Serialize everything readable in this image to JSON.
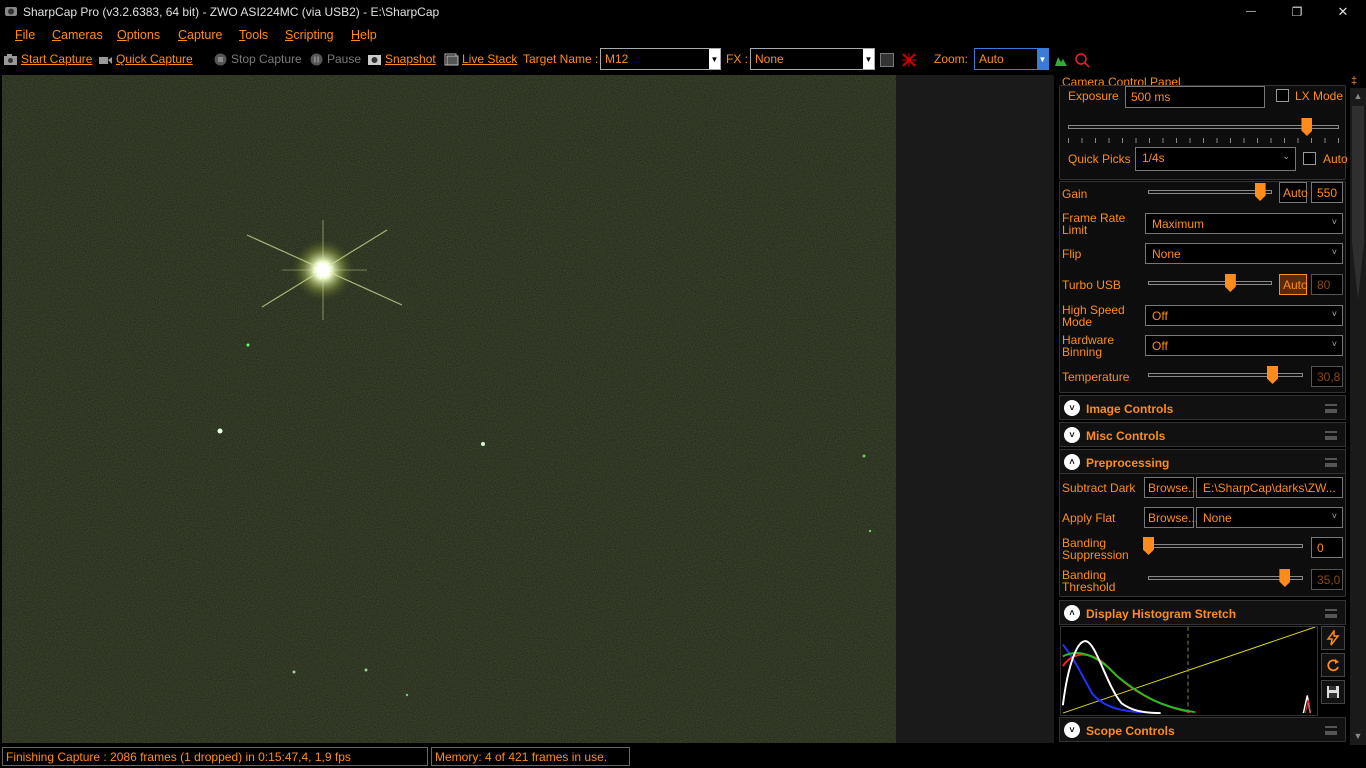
{
  "window": {
    "title": "SharpCap Pro (v3.2.6383, 64 bit) - ZWO ASI224MC (via USB2) - E:\\SharpCap",
    "minimize_glyph": "—",
    "maximize_glyph": "❐",
    "close_glyph": "✕"
  },
  "menu": {
    "items": [
      {
        "label": "File",
        "underline": "F",
        "rest": "ile"
      },
      {
        "label": "Cameras",
        "underline": "C",
        "rest": "ameras"
      },
      {
        "label": "Options",
        "underline": "O",
        "rest": "ptions"
      },
      {
        "label": "Capture",
        "underline": "C",
        "rest": "apture"
      },
      {
        "label": "Tools",
        "underline": "T",
        "rest": "ools"
      },
      {
        "label": "Scripting",
        "underline": "S",
        "rest": "cripting"
      },
      {
        "label": "Help",
        "underline": "H",
        "rest": "elp"
      }
    ]
  },
  "toolbar": {
    "start_capture": "Start Capture",
    "quick_capture": "Quick Capture",
    "stop_capture": "Stop Capture",
    "pause": "Pause",
    "snapshot": "Snapshot",
    "live_stack": "Live Stack",
    "target_name_label": "Target Name :",
    "target_name_value": "M12",
    "fx_label": "FX :",
    "fx_value": "None",
    "zoom_label": "Zoom:",
    "zoom_value": "Auto",
    "dropdown_glyph": "▼"
  },
  "camera_panel": {
    "title": "Camera Control Panel",
    "pin_glyph": "‡",
    "exposure_label": "Exposure",
    "exposure_value": "500 ms",
    "lx_mode_label": "LX Mode",
    "exposure_level": 0.88,
    "quick_picks_label": "Quick Picks",
    "quick_picks_value": "1/4s",
    "auto_label": "Auto",
    "gain_label": "Gain",
    "gain_auto": "Auto",
    "gain_value": "550",
    "gain_level": 0.9,
    "frame_rate_label_1": "Frame Rate",
    "frame_rate_label_2": "Limit",
    "frame_rate_value": "Maximum",
    "flip_label": "Flip",
    "flip_value": "None",
    "turbo_usb_label": "Turbo USB",
    "turbo_usb_auto": "Auto",
    "turbo_usb_value": "80",
    "turbo_usb_level": 0.66,
    "high_speed_label_1": "High Speed",
    "high_speed_label_2": "Mode",
    "high_speed_value": "Off",
    "hardware_binning_label_1": "Hardware",
    "hardware_binning_label_2": "Binning",
    "hardware_binning_value": "Off",
    "temperature_label": "Temperature",
    "temperature_value": "30,8",
    "temperature_level": 0.8,
    "chevron_down": "⌄",
    "arrow_down": "˅"
  },
  "sections": {
    "image_controls": "Image Controls",
    "misc_controls": "Misc Controls",
    "preprocessing": "Preprocessing",
    "display_histogram_stretch": "Display Histogram Stretch",
    "scope_controls": "Scope Controls",
    "collapsed_glyph": "˅",
    "expanded_glyph": "˄"
  },
  "preprocessing": {
    "subtract_dark_label": "Subtract Dark",
    "browse_label": "Browse...",
    "subtract_dark_value": "E:\\SharpCap\\darks\\ZW...",
    "apply_flat_label": "Apply Flat",
    "apply_flat_value": "None",
    "banding_suppression_label_1": "Banding",
    "banding_suppression_label_2": "Suppression",
    "banding_suppression_value": "0",
    "banding_suppression_level": 0.0,
    "banding_threshold_label_1": "Banding",
    "banding_threshold_label_2": "Threshold",
    "banding_threshold_value": "35,0",
    "banding_threshold_level": 0.88
  },
  "scrollbar": {
    "up_glyph": "▲",
    "down_glyph": "▼"
  },
  "status": {
    "capture": "Finishing Capture : 2086 frames (1 dropped) in 0:15:47,4, 1,9 fps",
    "memory": "Memory: 4 of 421 frames in use."
  },
  "colors": {
    "accent": "#ff8c1a",
    "image_background": "#1b2012"
  }
}
